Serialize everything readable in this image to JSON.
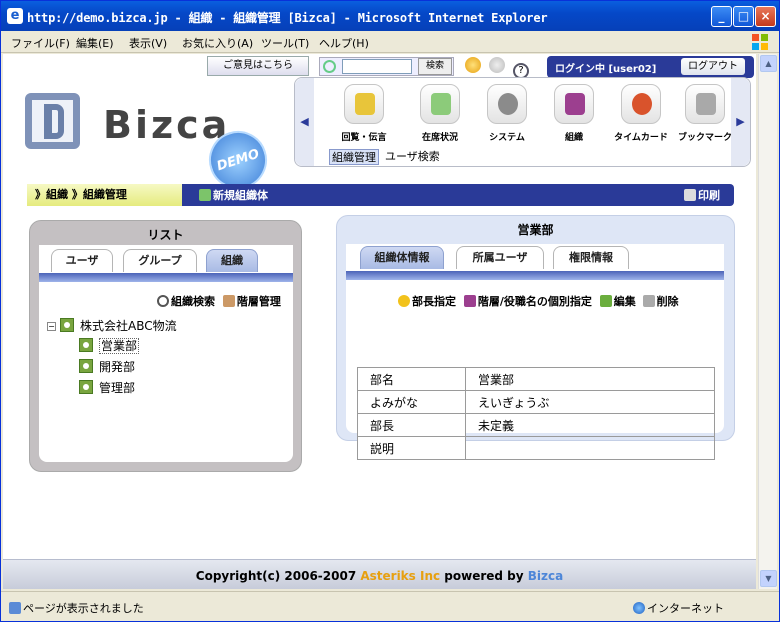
{
  "window": {
    "title": "http://demo.bizca.jp - 組織 - 組織管理 [Bizca] - Microsoft Internet Explorer",
    "minimize": "_",
    "maximize": "□",
    "close": "×"
  },
  "menu": [
    "ファイル(F)",
    "編集(E)",
    "表示(V)",
    "お気に入り(A)",
    "ツール(T)",
    "ヘルプ(H)"
  ],
  "header": {
    "feedback": "ご意見はこちら",
    "search_value": "",
    "search_button": "検索",
    "help": "?",
    "login_status": "ログイン中 [user02]",
    "logout": "ログアウト"
  },
  "logo": {
    "text": "Bizca",
    "badge": "DEMO"
  },
  "apps": [
    {
      "label": "回覧・伝言",
      "color": "#E8C53A"
    },
    {
      "label": "在席状況",
      "color": "#8CCB7A"
    },
    {
      "label": "システム",
      "color": "#8B8B8B"
    },
    {
      "label": "組織",
      "color": "#9C3F8F"
    },
    {
      "label": "タイムカード",
      "color": "#D9532C"
    },
    {
      "label": "ブックマーク",
      "color": "#A9A9A9"
    }
  ],
  "launcher_nav": {
    "left": "◀",
    "right": "▶"
  },
  "subtabs": [
    "組織管理",
    "ユーザ検索"
  ],
  "breadcrumb": {
    "path": "》組織 》組織管理",
    "new_org": "新規組織体",
    "print": "印刷"
  },
  "left_panel": {
    "title": "リスト",
    "tabs": [
      "ユーザ",
      "グループ",
      "組織"
    ],
    "org_search": "組織検索",
    "hierarchy": "階層管理",
    "tree": {
      "collapse": "−",
      "root": "株式会社ABC物流",
      "children": [
        "営業部",
        "開発部",
        "管理部"
      ]
    }
  },
  "right_panel": {
    "title": "営業部",
    "tabs": [
      "組織体情報",
      "所属ユーザ",
      "権限情報"
    ],
    "actions": {
      "head": "部長指定",
      "individual": "階層/役職名の個別指定",
      "edit": "編集",
      "delete": "削除"
    },
    "rows": [
      {
        "key": "部名",
        "value": "営業部"
      },
      {
        "key": "よみがな",
        "value": "えいぎょうぶ"
      },
      {
        "key": "部長",
        "value": "未定義"
      },
      {
        "key": "説明",
        "value": ""
      }
    ]
  },
  "footer": {
    "prefix": "Copyright(c) 2006-2007 ",
    "company": "Asteriks Inc",
    "middle": " powered by ",
    "product": "Bizca"
  },
  "status": {
    "message": "ページが表示されました",
    "zone": "インターネット"
  },
  "colors": {
    "nav_blue": "#2A3A98",
    "crumb_yellow": "#E5EB7E",
    "footer_orange": "#E7A010"
  }
}
